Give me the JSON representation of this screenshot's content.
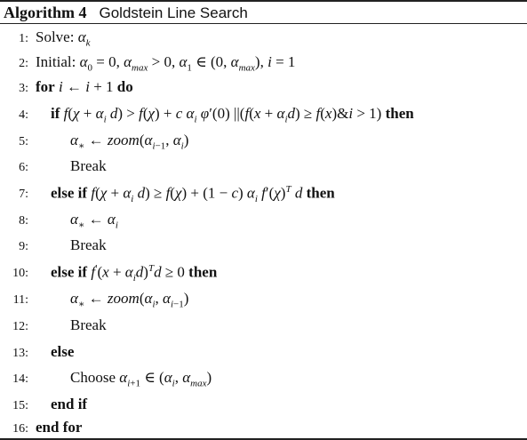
{
  "caption": {
    "label": "Algorithm 4",
    "title": "Goldstein Line Search"
  },
  "lines": [
    {
      "num": "1:",
      "text": "Solve: αk"
    },
    {
      "num": "2:",
      "text": "Initial: α0 = 0, αmax > 0, α1 ∈ (0, αmax), i = 1"
    },
    {
      "num": "3:",
      "text": "for i ← i + 1 do"
    },
    {
      "num": "4:",
      "text": "if f(χ + αi d) > f(χ) + c αi φ′(0) ||(f(x + αid) ≥ f(x)&i > 1) then"
    },
    {
      "num": "5:",
      "text": "α* ← zoom(αi−1, αi)"
    },
    {
      "num": "6:",
      "text": "Break"
    },
    {
      "num": "7:",
      "text": "else if f(χ + αi d) ≥ f(χ) + (1 − c) αi f′(χ)T d then"
    },
    {
      "num": "8:",
      "text": "α* ← αi"
    },
    {
      "num": "9:",
      "text": "Break"
    },
    {
      "num": "10:",
      "text": "else if f′(x + αid)T d ≥ 0 then"
    },
    {
      "num": "11:",
      "text": "α* ← zoom(αi, αi−1)"
    },
    {
      "num": "12:",
      "text": "Break"
    },
    {
      "num": "13:",
      "text": "else"
    },
    {
      "num": "14:",
      "text": "Choose αi+1 ∈ (αi, αmax)"
    },
    {
      "num": "15:",
      "text": "end if"
    },
    {
      "num": "16:",
      "text": "end for"
    }
  ]
}
